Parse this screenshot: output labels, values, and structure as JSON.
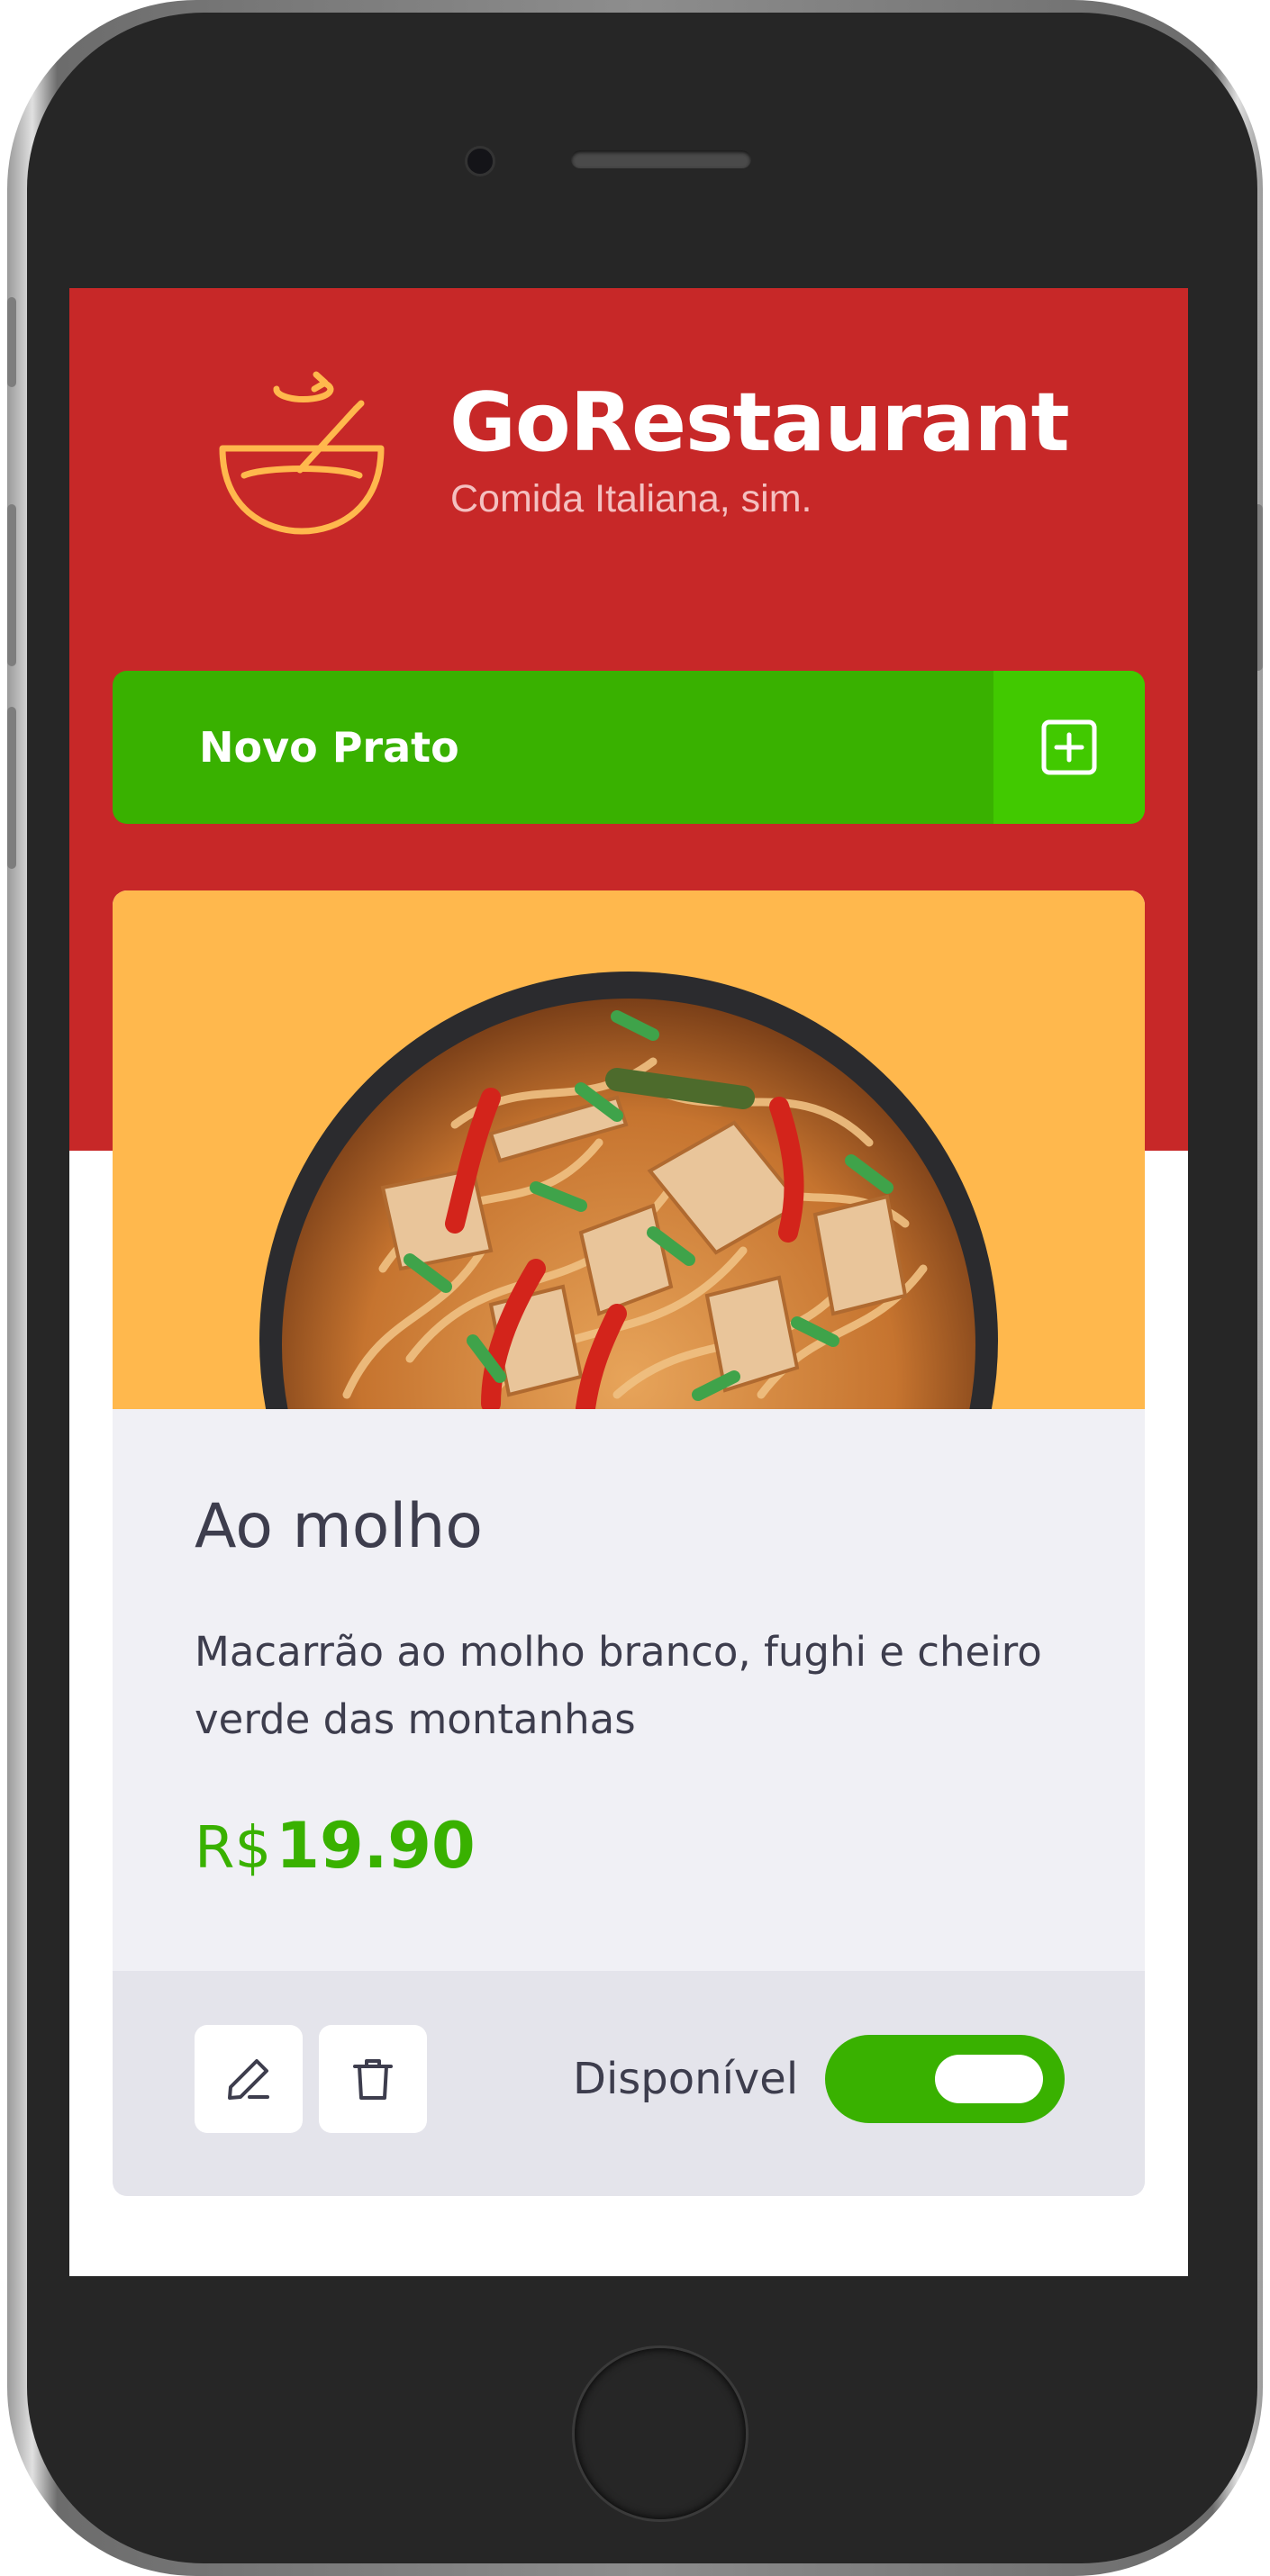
{
  "app": {
    "name": "GoRestaurant",
    "tagline": "Comida Italiana, sim."
  },
  "toolbar": {
    "new_dish_label": "Novo Prato"
  },
  "food": {
    "name": "Ao molho",
    "description": "Macarrão ao molho branco, fughi e cheiro verde das montanhas",
    "currency": "R$",
    "price": "19.90",
    "availability_label": "Disponível",
    "available": true
  },
  "icons": {
    "logo": "bowl-logo-icon",
    "new_dish": "plus-square-icon",
    "edit": "pencil-icon",
    "delete": "trash-icon"
  },
  "colors": {
    "header": "#c72828",
    "primary_green": "#39b100",
    "accent_green": "#41c900",
    "image_background": "#ffb84d",
    "card_background": "#f0f0f5",
    "card_footer": "#e4e4eb",
    "text_dark": "#3d3d4d",
    "logo_color": "#ffb84d"
  }
}
